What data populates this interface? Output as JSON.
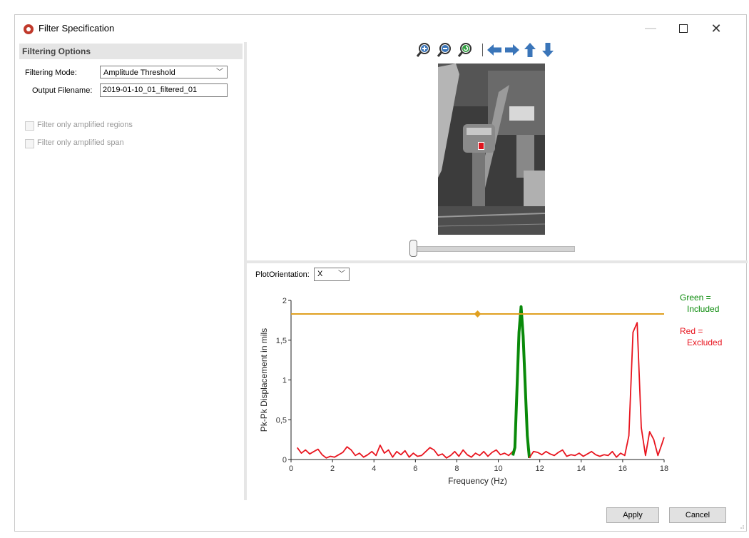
{
  "window": {
    "title": "Filter Specification",
    "app_icon": "app-logo-icon"
  },
  "filtering_options": {
    "header": "Filtering Options",
    "mode_label": "Filtering Mode:",
    "mode_value": "Amplitude Threshold",
    "filename_label": "Output Filename:",
    "filename_value": "2019-01-10_01_filtered_01",
    "check_regions_label": "Filter only amplified regions",
    "check_regions_checked": false,
    "check_span_label": "Filter only amplified span",
    "check_span_checked": false
  },
  "toolbar": {
    "icons": [
      "zoom-in-icon",
      "zoom-out-icon",
      "zoom-reset-icon",
      "arrow-left-icon",
      "arrow-right-icon",
      "arrow-up-icon",
      "arrow-down-icon"
    ],
    "color": "#3a75b9"
  },
  "video": {
    "frame_slider_fraction": 0
  },
  "plot": {
    "orientation_label": "PlotOrientation:",
    "orientation_value": "X"
  },
  "buttons": {
    "apply": "Apply",
    "cancel": "Cancel"
  },
  "chart_data": {
    "type": "line",
    "xlabel": "Frequency (Hz)",
    "ylabel": "Pk-Pk Displacement in mils",
    "xlim": [
      0,
      18
    ],
    "ylim": [
      0,
      2
    ],
    "x_ticks": [
      "0",
      "2",
      "4",
      "6",
      "8",
      "10",
      "12",
      "14",
      "16",
      "18"
    ],
    "y_ticks": [
      "0",
      "0,5",
      "1",
      "1,5",
      "2"
    ],
    "threshold": {
      "value": 1.83,
      "handle_x": 9.0,
      "color": "#e0a020"
    },
    "legend": [
      {
        "text": "Green =\n  Included",
        "color": "#0a8a0a"
      },
      {
        "text": "Red =\n  Excluded",
        "color": "#e8141e"
      }
    ],
    "series": [
      {
        "color": "#e8141e",
        "x": [
          0.3,
          0.5,
          0.7,
          0.9,
          1.1,
          1.3,
          1.5,
          1.7,
          1.9,
          2.1,
          2.3,
          2.5,
          2.7,
          2.9,
          3.1,
          3.3,
          3.5,
          3.7,
          3.9,
          4.1,
          4.3,
          4.5,
          4.7,
          4.9,
          5.1,
          5.3,
          5.5,
          5.7,
          5.9,
          6.1,
          6.3,
          6.5,
          6.7,
          6.9,
          7.1,
          7.3,
          7.5,
          7.7,
          7.9,
          8.1,
          8.3,
          8.5,
          8.7,
          8.9,
          9.1,
          9.3,
          9.5,
          9.7,
          9.9,
          10.1,
          10.3,
          10.5,
          10.7
        ],
        "y": [
          0.15,
          0.08,
          0.12,
          0.07,
          0.1,
          0.13,
          0.06,
          0.02,
          0.04,
          0.03,
          0.06,
          0.09,
          0.16,
          0.12,
          0.05,
          0.08,
          0.03,
          0.06,
          0.1,
          0.05,
          0.18,
          0.08,
          0.12,
          0.03,
          0.1,
          0.06,
          0.11,
          0.03,
          0.08,
          0.04,
          0.05,
          0.1,
          0.15,
          0.12,
          0.05,
          0.07,
          0.02,
          0.05,
          0.1,
          0.04,
          0.12,
          0.06,
          0.03,
          0.08,
          0.05,
          0.1,
          0.04,
          0.09,
          0.12,
          0.06,
          0.08,
          0.05,
          0.1
        ]
      },
      {
        "color": "#0a8a0a",
        "x": [
          10.7,
          10.8,
          11.0,
          11.1,
          11.2,
          11.4,
          11.5
        ],
        "y": [
          0.05,
          0.15,
          1.6,
          1.92,
          1.55,
          0.3,
          0.02
        ]
      },
      {
        "color": "#e8141e",
        "x": [
          11.5,
          11.7,
          11.9,
          12.1,
          12.3,
          12.5,
          12.7,
          12.9,
          13.1,
          13.3,
          13.5,
          13.7,
          13.9,
          14.1,
          14.3,
          14.5,
          14.7,
          14.9,
          15.1,
          15.3,
          15.5,
          15.7,
          15.9,
          16.1,
          16.3,
          16.5,
          16.7,
          16.9,
          17.1,
          17.3,
          17.5,
          17.7,
          17.9,
          18.0
        ],
        "y": [
          0.02,
          0.1,
          0.09,
          0.06,
          0.1,
          0.07,
          0.05,
          0.09,
          0.12,
          0.04,
          0.06,
          0.05,
          0.08,
          0.04,
          0.07,
          0.1,
          0.06,
          0.04,
          0.06,
          0.05,
          0.1,
          0.03,
          0.08,
          0.05,
          0.3,
          1.6,
          1.72,
          0.4,
          0.05,
          0.35,
          0.25,
          0.05,
          0.2,
          0.28
        ]
      }
    ]
  }
}
